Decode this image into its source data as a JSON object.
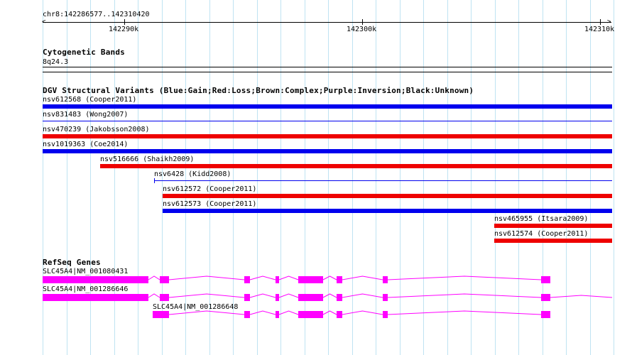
{
  "ruler": {
    "range_label": "chr8:142286577..142310420",
    "ticks": [
      {
        "label": "142290k"
      },
      {
        "label": "142300k"
      },
      {
        "label": "142310k"
      }
    ]
  },
  "cytoband": {
    "title": "Cytogenetic Bands",
    "band": "8q24.3"
  },
  "dgv": {
    "title": "DGV Structural Variants (Blue:Gain;Red:Loss;Brown:Complex;Purple:Inversion;Black:Unknown)",
    "colors": {
      "gain": "#0000ee",
      "loss": "#ee0000"
    },
    "variants": [
      {
        "label": "nsv612568 (Cooper2011)",
        "type": "gain",
        "style": "thick"
      },
      {
        "label": "nsv831483 (Wong2007)",
        "type": "gain",
        "style": "thin"
      },
      {
        "label": "nsv470239 (Jakobsson2008)",
        "type": "loss",
        "style": "thick"
      },
      {
        "label": "nsv1019363 (Coe2014)",
        "type": "gain",
        "style": "thick"
      },
      {
        "label": "nsv516666 (Shaikh2009)",
        "type": "loss",
        "style": "thick"
      },
      {
        "label": "nsv6428 (Kidd2008)",
        "type": "gain",
        "style": "thin"
      },
      {
        "label": "nsv612572 (Cooper2011)",
        "type": "loss",
        "style": "thick"
      },
      {
        "label": "nsv612573 (Cooper2011)",
        "type": "gain",
        "style": "thick"
      },
      {
        "label": "nsv465955 (Itsara2009)",
        "type": "loss",
        "style": "thick"
      },
      {
        "label": "nsv612574 (Cooper2011)",
        "type": "loss",
        "style": "thick"
      }
    ]
  },
  "refseq": {
    "title": "RefSeq Genes",
    "color": "#ff00ff",
    "genes": [
      {
        "label": "SLC45A4|NM_001080431"
      },
      {
        "label": "SLC45A4|NM_001286646"
      },
      {
        "label": "SLC45A4|NM_001286648"
      }
    ]
  }
}
